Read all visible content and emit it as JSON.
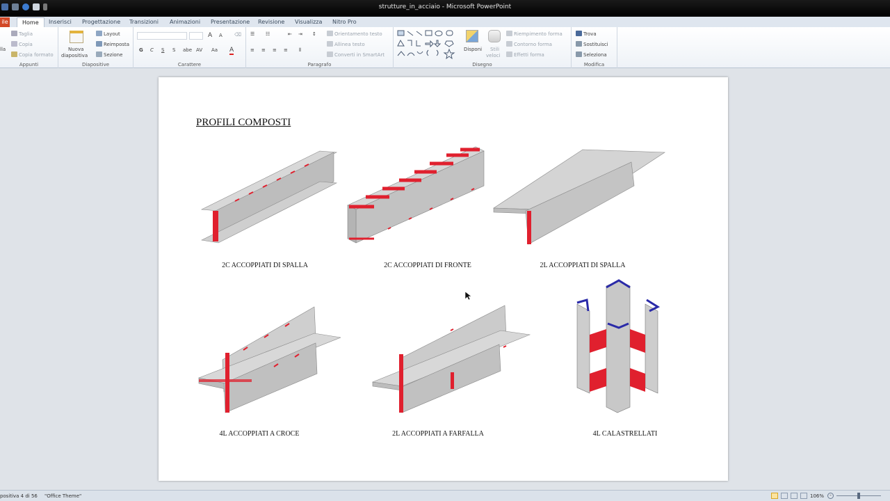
{
  "window": {
    "title": "strutture_in_acciaio - Microsoft PowerPoint"
  },
  "tabs": {
    "file": "ile",
    "home": "Home",
    "insert": "Inserisci",
    "design": "Progettazione",
    "transitions": "Transizioni",
    "animations": "Animazioni",
    "presentation": "Presentazione",
    "review": "Revisione",
    "view": "Visualizza",
    "nitro": "Nitro Pro"
  },
  "ribbon": {
    "clipboard": {
      "label": "Appunti",
      "cut": "Taglia",
      "copy": "Copia",
      "format_painter": "Copia formato",
      "paste": "lla"
    },
    "slides": {
      "label": "Diapositive",
      "new_slide_line1": "Nuova",
      "new_slide_line2": "diapositiva",
      "layout": "Layout",
      "reset": "Reimposta",
      "section": "Sezione"
    },
    "font": {
      "label": "Carattere",
      "bold": "G",
      "italic": "C",
      "underline": "S",
      "shadow": "S",
      "strike": "abe",
      "spacing": "AV",
      "case": "Aa"
    },
    "paragraph": {
      "label": "Paragrafo",
      "text_direction": "Orientamento testo",
      "align_text": "Allinea testo",
      "smartart": "Converti in SmartArt"
    },
    "drawing": {
      "label": "Disegno",
      "arrange": "Disponi",
      "quick_styles_line1": "Stili",
      "quick_styles_line2": "veloci",
      "shape_fill": "Riempimento forma",
      "shape_outline": "Contorno forma",
      "shape_effects": "Effetti forma"
    },
    "editing": {
      "label": "Modifica",
      "find": "Trova",
      "replace": "Sostituisci",
      "select": "Seleziona"
    }
  },
  "slide": {
    "title": "PROFILI COMPOSTI",
    "captions": [
      "2C  ACCOPPIATI DI SPALLA",
      "2C  ACCOPPIATI DI FRONTE",
      "2L  ACCOPPIATI DI SPALLA",
      "4L  ACCOPPIATI A CROCE",
      "2L  ACCOPPIATI A FARFALLA",
      "4L  CALASTRELLATI"
    ]
  },
  "statusbar": {
    "slide_info": "positiva 4 di 56",
    "theme": "\"Office Theme\"",
    "zoom": "106%"
  },
  "colors": {
    "steel": "#c9c9c9",
    "weld": "#e0202e",
    "plate_outline": "#2a2aa8",
    "ribbon_accent": "#d24726"
  }
}
